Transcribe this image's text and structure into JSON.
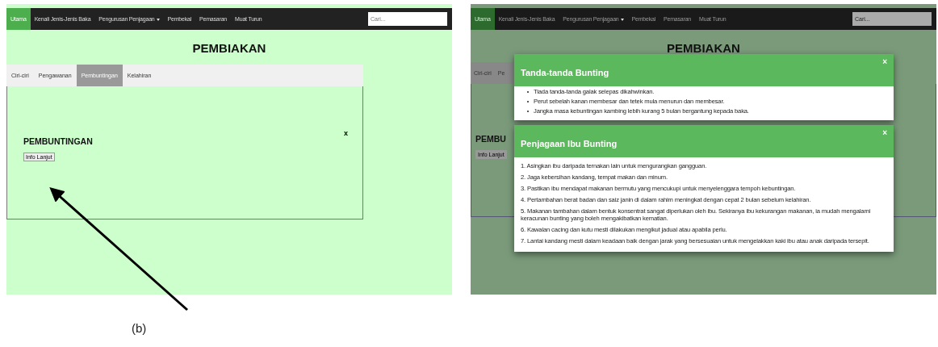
{
  "screens": [
    {
      "dimmed": false,
      "nav": [
        {
          "label": "Utama",
          "kind": "link",
          "selected": true
        },
        {
          "label": "Kenali Jenis-Jenis Baka",
          "kind": "link",
          "selected": false
        },
        {
          "label": "Pengurusan Penjagaan",
          "kind": "dropdown",
          "selected": false
        },
        {
          "label": "Pembekal",
          "kind": "link",
          "selected": false
        },
        {
          "label": "Pemasaran",
          "kind": "link",
          "selected": false
        },
        {
          "label": "Muat Turun",
          "kind": "link",
          "selected": false
        }
      ],
      "search": {
        "placeholder": "Cari..."
      },
      "title": "PEMBIAKAN",
      "tabs": [
        {
          "label": "Ciri-ciri",
          "selected": false
        },
        {
          "label": "Pengawanan",
          "selected": false
        },
        {
          "label": "Pembuntingan",
          "selected": true
        },
        {
          "label": "Kelahiran",
          "selected": false
        }
      ],
      "panel": {
        "heading": "PEMBUNTINGAN",
        "close": "x",
        "button": "Info Lanjut"
      }
    },
    {
      "dimmed": true,
      "nav": [
        {
          "label": "Utama",
          "kind": "link",
          "selected": true
        },
        {
          "label": "Kenali Jenis-Jenis Baka",
          "kind": "link",
          "selected": false
        },
        {
          "label": "Pengurusan Penjagaan",
          "kind": "dropdown",
          "selected": false
        },
        {
          "label": "Pembekal",
          "kind": "link",
          "selected": false
        },
        {
          "label": "Pemasaran",
          "kind": "link",
          "selected": false
        },
        {
          "label": "Muat Turun",
          "kind": "link",
          "selected": false
        }
      ],
      "search": {
        "placeholder": "Cari..."
      },
      "title": "PEMBIAKAN",
      "tabs": [
        {
          "label": "Ciri-ciri",
          "selected": false
        },
        {
          "label": "Pe",
          "selected": false
        }
      ],
      "panel": {
        "heading": "PEMBU",
        "button": "Info Lanjut"
      },
      "modals": [
        {
          "title": "Tanda-tanda Bunting",
          "close": "×",
          "kind": "bullets",
          "items": [
            "Tiada tanda-tanda galak selepas dikahwinkan.",
            "Perut sebelah kanan membesar dan tetek mula menurun dan membesar.",
            "Jangka masa kebuntingan kambing lebih kurang 5 bulan bergantung kepada baka."
          ]
        },
        {
          "title": "Penjagaan Ibu Bunting",
          "close": "×",
          "kind": "numbered",
          "items": [
            "1. Asingkan ibu daripada ternakan lain untuk mengurangkan gangguan.",
            "2. Jaga kebersihan kandang, tempat makan dan minum.",
            "3. Pastikan ibu mendapat makanan bermutu yang mencukupi untuk menyelenggara tempoh kebuntingan.",
            "4. Pertambahan berat badan dan saiz janin di dalam rahim meningkat dengan cepat 2 bulan sebelum kelahiran.",
            "5. Makanan tambahan dalam bentuk konsentrat sangat diperlukan oleh ibu. Sekiranya ibu kekurangan makanan, ia mudah mengalami keracunan bunting yang boleh mengakibatkan kematian.",
            "6. Kawalan cacing dan kutu mesti dilakukan mengikut jadual atau apabila perlu.",
            "7. Lantai kandang mesti dalam keadaan baik dengan jarak yang bersesuaian untuk mengelakkan kaki ibu atau anak daripada tersepit."
          ]
        }
      ]
    }
  ],
  "caption": "(b)"
}
